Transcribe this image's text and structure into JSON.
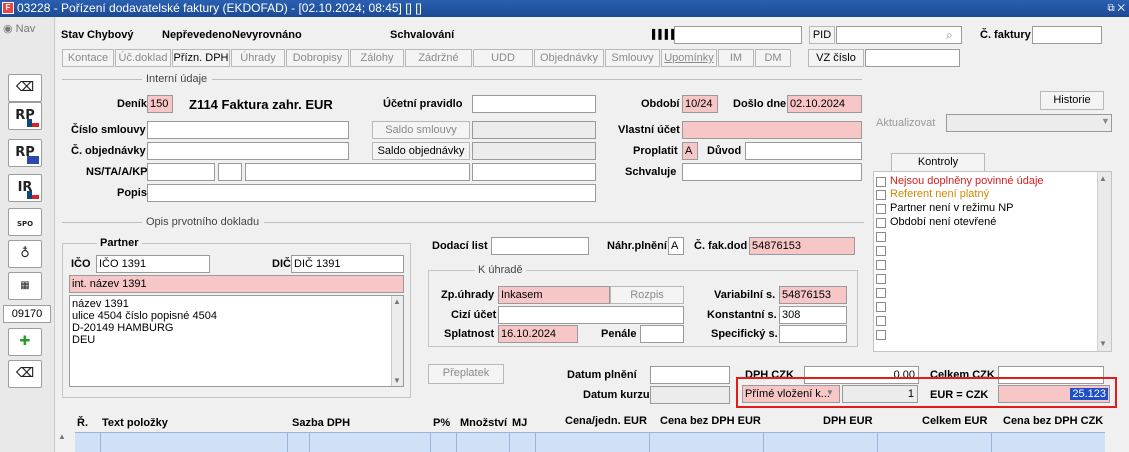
{
  "window": {
    "title": "03228 - Pořízení dodavatelské faktury (EKDOFAD) - [02.10.2024; 08:45] [] []",
    "controls": "⧉ ✕"
  },
  "nav": {
    "label": "Nav",
    "buttons": [
      "RP",
      "RP",
      "IR",
      "SPO",
      "",
      "",
      "09170",
      "",
      ""
    ]
  },
  "status": {
    "stav_label": "Stav",
    "stav_value": "Chybový",
    "neprevedeno": "Nepřevedeno",
    "nevyrovnano": "Nevyrovnáno",
    "schvalovani": "Schvalování",
    "pid_label": "PID",
    "c_faktury_label": "Č. faktury"
  },
  "tabs": {
    "items": [
      "Kontace",
      "Úč.doklad",
      "Přízn. DPH",
      "Úhrady",
      "Dobropisy",
      "Zálohy",
      "Zádržné",
      "UDD",
      "Objednávky",
      "Smlouvy",
      "Upomínky",
      "IM",
      "DM"
    ],
    "vz_cislo": "VZ číslo"
  },
  "interni": {
    "section": "Interní údaje",
    "denik_label": "Deník",
    "denik_value": "150",
    "denik_name": "Z114 Faktura zahr. EUR",
    "ucetni_pravidlo_label": "Účetní pravidlo",
    "obdobi_label": "Období",
    "obdobi_value": "10/24",
    "doslo_dne_label": "Došlo dne",
    "doslo_dne_value": "02.10.2024",
    "historie": "Historie",
    "cislo_smlouvy_label": "Číslo smlouvy",
    "saldo_smlouvy": "Saldo smlouvy",
    "vlastni_ucet_label": "Vlastní účet",
    "aktualizovat": "Aktualizovat",
    "c_objednavky_label": "Č. objednávky",
    "saldo_objednavky": "Saldo objednávky",
    "proplatit_label": "Proplatit",
    "proplatit_value": "A",
    "duvod_label": "Důvod",
    "ns_label": "NS/TA/A/KP",
    "schvaluje_label": "Schvaluje",
    "popis_label": "Popis"
  },
  "kontroly": {
    "button": "Kontroly",
    "items": [
      {
        "text": "Nejsou doplněny povinné údaje",
        "color": "#d42020"
      },
      {
        "text": "Referent není platný",
        "color": "#d08a00"
      },
      {
        "text": "Partner není v režimu NP",
        "color": "#000000"
      },
      {
        "text": "Období není otevřené",
        "color": "#000000"
      }
    ]
  },
  "opis": {
    "section": "Opis prvotního dokladu",
    "partner_label": "Partner",
    "ico_label": "IČO",
    "ico_value": "IČO 1391",
    "dic_label": "DIČ",
    "dic_value": "DIČ 1391",
    "int_nazev": "int. název 1391",
    "address": [
      "název 1391",
      "ulice 4504 číslo popisné 4504",
      "D-20149 HAMBURG",
      "DEU"
    ],
    "dodaci_list_label": "Dodací list",
    "nahr_plneni_label": "Náhr.plnění",
    "nahr_plneni_value": "A",
    "c_fak_dod_label": "Č. fak.dod",
    "c_fak_dod_value": "54876153"
  },
  "k_uhrade": {
    "section": "K úhradě",
    "zp_uhrady_label": "Zp.úhrady",
    "zp_uhrady_value": "Inkasem",
    "rozpis": "Rozpis",
    "variabilni_label": "Variabilní s.",
    "variabilni_value": "54876153",
    "cizi_ucet_label": "Cizí účet",
    "konstantni_label": "Konstantní s.",
    "konstantni_value": "308",
    "splatnost_label": "Splatnost",
    "splatnost_value": "16.10.2024",
    "penale_label": "Penále",
    "specificky_label": "Specifický s."
  },
  "totals": {
    "preplatek": "Přeplatek",
    "datum_plneni_label": "Datum plnění",
    "dph_czk_label": "DPH CZK",
    "dph_czk_value": "0.00",
    "celkem_czk_label": "Celkem CZK",
    "datum_kurzu_label": "Datum kurzu",
    "kurz_select": "Přímé vložení k...",
    "kurz_qty": "1",
    "eur_czk_label": "EUR = CZK",
    "eur_czk_value": "25.123"
  },
  "table": {
    "columns": [
      {
        "label": "Ř.",
        "unit": ""
      },
      {
        "label": "Text položky",
        "unit": ""
      },
      {
        "label": "Sazba DPH",
        "unit": ""
      },
      {
        "label": "P%",
        "unit": ""
      },
      {
        "label": "Množství",
        "unit": ""
      },
      {
        "label": "MJ",
        "unit": ""
      },
      {
        "label": "Cena/jedn.",
        "unit": "EUR"
      },
      {
        "label": "Cena bez DPH",
        "unit": "EUR"
      },
      {
        "label": "DPH",
        "unit": "EUR"
      },
      {
        "label": "Celkem",
        "unit": "EUR"
      },
      {
        "label": "Cena bez DPH",
        "unit": "CZK"
      }
    ]
  }
}
